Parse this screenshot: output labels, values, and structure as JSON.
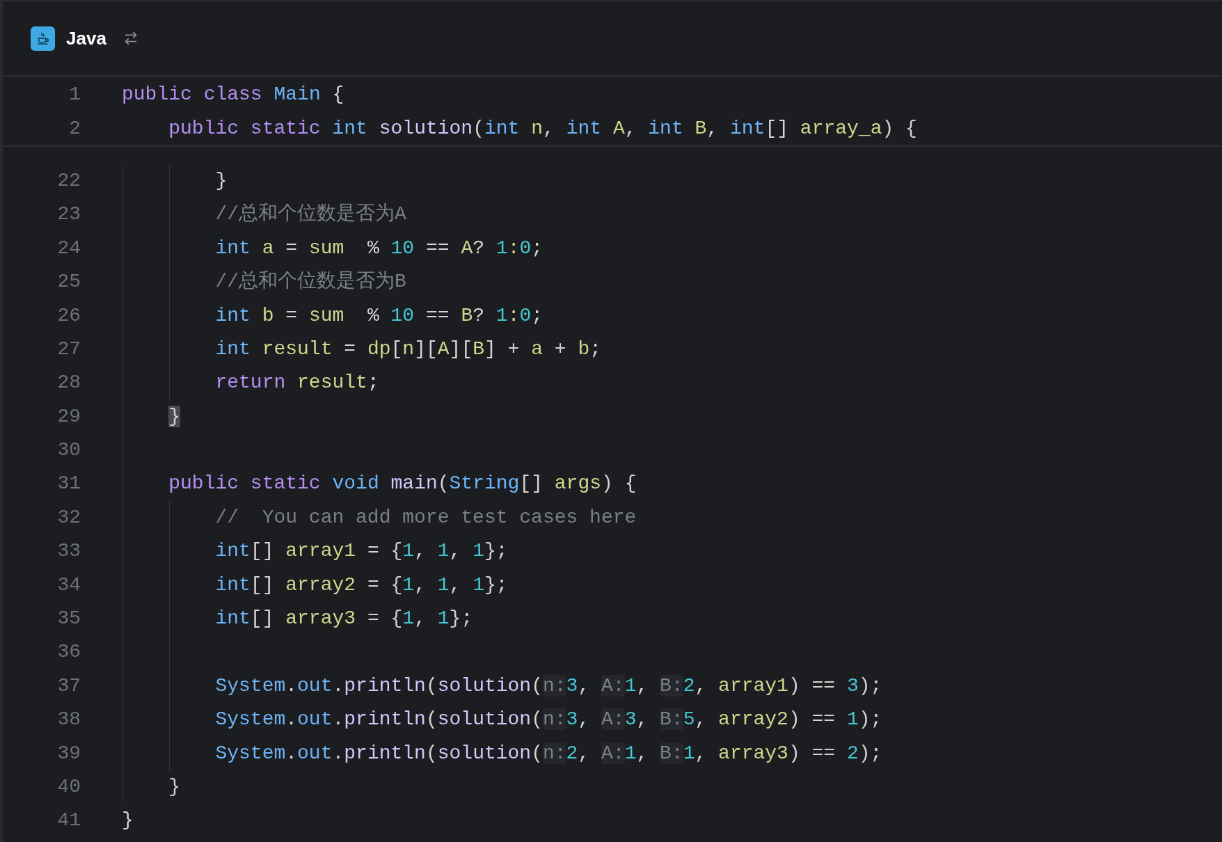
{
  "tab": {
    "language": "Java"
  },
  "sticky_lines": [
    {
      "number": "1",
      "tokens": [
        {
          "kind": "keyword",
          "text": "public"
        },
        {
          "kind": "keyword",
          "text": " class"
        },
        {
          "kind": "type",
          "text": " Main"
        },
        {
          "kind": "plain",
          "text": " {"
        }
      ]
    },
    {
      "number": "2",
      "tokens": [
        {
          "kind": "keyword",
          "text": "    public"
        },
        {
          "kind": "keyword",
          "text": " static"
        },
        {
          "kind": "type",
          "text": " int"
        },
        {
          "kind": "function",
          "text": " solution"
        },
        {
          "kind": "plain",
          "text": "("
        },
        {
          "kind": "type",
          "text": "int"
        },
        {
          "kind": "variable",
          "text": " n"
        },
        {
          "kind": "plain",
          "text": ","
        },
        {
          "kind": "type",
          "text": " int"
        },
        {
          "kind": "variable",
          "text": " A"
        },
        {
          "kind": "plain",
          "text": ","
        },
        {
          "kind": "type",
          "text": " int"
        },
        {
          "kind": "variable",
          "text": " B"
        },
        {
          "kind": "plain",
          "text": ","
        },
        {
          "kind": "type",
          "text": " int"
        },
        {
          "kind": "plain",
          "text": "[]"
        },
        {
          "kind": "variable",
          "text": " array_a"
        },
        {
          "kind": "plain",
          "text": ") {"
        }
      ]
    }
  ],
  "lines": [
    {
      "number": "22",
      "tokens": [
        {
          "kind": "plain",
          "text": "        }"
        }
      ]
    },
    {
      "number": "23",
      "tokens": [
        {
          "kind": "comment",
          "text": "        //总和个位数是否为A"
        }
      ]
    },
    {
      "number": "24",
      "tokens": [
        {
          "kind": "type",
          "text": "        int"
        },
        {
          "kind": "variable",
          "text": " a"
        },
        {
          "kind": "plain",
          "text": " ="
        },
        {
          "kind": "variable",
          "text": " sum"
        },
        {
          "kind": "plain",
          "text": "  % "
        },
        {
          "kind": "number",
          "text": "10"
        },
        {
          "kind": "plain",
          "text": " =="
        },
        {
          "kind": "variable",
          "text": " A"
        },
        {
          "kind": "plain",
          "text": "?"
        },
        {
          "kind": "number",
          "text": " 1"
        },
        {
          "kind": "variable",
          "text": ":"
        },
        {
          "kind": "number",
          "text": "0"
        },
        {
          "kind": "plain",
          "text": ";"
        }
      ]
    },
    {
      "number": "25",
      "tokens": [
        {
          "kind": "comment",
          "text": "        //总和个位数是否为B"
        }
      ]
    },
    {
      "number": "26",
      "tokens": [
        {
          "kind": "type",
          "text": "        int"
        },
        {
          "kind": "variable",
          "text": " b"
        },
        {
          "kind": "plain",
          "text": " ="
        },
        {
          "kind": "variable",
          "text": " sum"
        },
        {
          "kind": "plain",
          "text": "  % "
        },
        {
          "kind": "number",
          "text": "10"
        },
        {
          "kind": "plain",
          "text": " =="
        },
        {
          "kind": "variable",
          "text": " B"
        },
        {
          "kind": "plain",
          "text": "?"
        },
        {
          "kind": "number",
          "text": " 1"
        },
        {
          "kind": "variable",
          "text": ":"
        },
        {
          "kind": "number",
          "text": "0"
        },
        {
          "kind": "plain",
          "text": ";"
        }
      ]
    },
    {
      "number": "27",
      "tokens": [
        {
          "kind": "type",
          "text": "        int"
        },
        {
          "kind": "variable",
          "text": " result"
        },
        {
          "kind": "plain",
          "text": " ="
        },
        {
          "kind": "variable",
          "text": " dp"
        },
        {
          "kind": "plain",
          "text": "["
        },
        {
          "kind": "variable",
          "text": "n"
        },
        {
          "kind": "plain",
          "text": "]["
        },
        {
          "kind": "variable",
          "text": "A"
        },
        {
          "kind": "plain",
          "text": "]["
        },
        {
          "kind": "variable",
          "text": "B"
        },
        {
          "kind": "plain",
          "text": "] +"
        },
        {
          "kind": "variable",
          "text": " a"
        },
        {
          "kind": "plain",
          "text": " +"
        },
        {
          "kind": "variable",
          "text": " b"
        },
        {
          "kind": "plain",
          "text": ";"
        }
      ]
    },
    {
      "number": "28",
      "tokens": [
        {
          "kind": "keyword",
          "text": "        return"
        },
        {
          "kind": "variable",
          "text": " result"
        },
        {
          "kind": "plain",
          "text": ";"
        }
      ]
    },
    {
      "number": "29",
      "tokens": [
        {
          "kind": "brace_match",
          "text": "    }"
        }
      ]
    },
    {
      "number": "30"
    },
    {
      "number": "31",
      "tokens": [
        {
          "kind": "keyword",
          "text": "    public"
        },
        {
          "kind": "keyword",
          "text": " static"
        },
        {
          "kind": "type",
          "text": " void"
        },
        {
          "kind": "function",
          "text": " main"
        },
        {
          "kind": "plain",
          "text": "("
        },
        {
          "kind": "type",
          "text": "String"
        },
        {
          "kind": "plain",
          "text": "[]"
        },
        {
          "kind": "variable",
          "text": " args"
        },
        {
          "kind": "plain",
          "text": ") {"
        }
      ]
    },
    {
      "number": "32",
      "tokens": [
        {
          "kind": "comment",
          "text": "        //  You can add more test cases here"
        }
      ]
    },
    {
      "number": "33",
      "tokens": [
        {
          "kind": "type",
          "text": "        int"
        },
        {
          "kind": "plain",
          "text": "[]"
        },
        {
          "kind": "variable",
          "text": " array1"
        },
        {
          "kind": "plain",
          "text": " = {"
        },
        {
          "kind": "number",
          "text": "1"
        },
        {
          "kind": "plain",
          "text": ","
        },
        {
          "kind": "number",
          "text": " 1"
        },
        {
          "kind": "plain",
          "text": ","
        },
        {
          "kind": "number",
          "text": " 1"
        },
        {
          "kind": "plain",
          "text": "};"
        }
      ]
    },
    {
      "number": "34",
      "tokens": [
        {
          "kind": "type",
          "text": "        int"
        },
        {
          "kind": "plain",
          "text": "[]"
        },
        {
          "kind": "variable",
          "text": " array2"
        },
        {
          "kind": "plain",
          "text": " = {"
        },
        {
          "kind": "number",
          "text": "1"
        },
        {
          "kind": "plain",
          "text": ","
        },
        {
          "kind": "number",
          "text": " 1"
        },
        {
          "kind": "plain",
          "text": ","
        },
        {
          "kind": "number",
          "text": " 1"
        },
        {
          "kind": "plain",
          "text": "};"
        }
      ]
    },
    {
      "number": "35",
      "tokens": [
        {
          "kind": "type",
          "text": "        int"
        },
        {
          "kind": "plain",
          "text": "[]"
        },
        {
          "kind": "variable",
          "text": " array3"
        },
        {
          "kind": "plain",
          "text": " = {"
        },
        {
          "kind": "number",
          "text": "1"
        },
        {
          "kind": "plain",
          "text": ","
        },
        {
          "kind": "number",
          "text": " 1"
        },
        {
          "kind": "plain",
          "text": "};"
        }
      ]
    },
    {
      "number": "36"
    },
    {
      "number": "37",
      "tokens": [
        {
          "kind": "type",
          "text": "        System"
        },
        {
          "kind": "plain",
          "text": "."
        },
        {
          "kind": "type",
          "text": "out"
        },
        {
          "kind": "plain",
          "text": "."
        },
        {
          "kind": "function",
          "text": "println"
        },
        {
          "kind": "plain",
          "text": "("
        },
        {
          "kind": "function",
          "text": "solution"
        },
        {
          "kind": "plain",
          "text": "("
        },
        {
          "kind": "hint",
          "text": "n:"
        },
        {
          "kind": "number",
          "text": "3"
        },
        {
          "kind": "plain",
          "text": ","
        },
        {
          "kind": "hint",
          "text": " A:"
        },
        {
          "kind": "number",
          "text": "1"
        },
        {
          "kind": "plain",
          "text": ","
        },
        {
          "kind": "hint",
          "text": " B:"
        },
        {
          "kind": "number",
          "text": "2"
        },
        {
          "kind": "plain",
          "text": ","
        },
        {
          "kind": "variable",
          "text": " array1"
        },
        {
          "kind": "plain",
          "text": ") =="
        },
        {
          "kind": "number",
          "text": " 3"
        },
        {
          "kind": "plain",
          "text": ");"
        }
      ]
    },
    {
      "number": "38",
      "tokens": [
        {
          "kind": "type",
          "text": "        System"
        },
        {
          "kind": "plain",
          "text": "."
        },
        {
          "kind": "type",
          "text": "out"
        },
        {
          "kind": "plain",
          "text": "."
        },
        {
          "kind": "function",
          "text": "println"
        },
        {
          "kind": "plain",
          "text": "("
        },
        {
          "kind": "function",
          "text": "solution"
        },
        {
          "kind": "plain",
          "text": "("
        },
        {
          "kind": "hint",
          "text": "n:"
        },
        {
          "kind": "number",
          "text": "3"
        },
        {
          "kind": "plain",
          "text": ","
        },
        {
          "kind": "hint",
          "text": " A:"
        },
        {
          "kind": "number",
          "text": "3"
        },
        {
          "kind": "plain",
          "text": ","
        },
        {
          "kind": "hint",
          "text": " B:"
        },
        {
          "kind": "number",
          "text": "5"
        },
        {
          "kind": "plain",
          "text": ","
        },
        {
          "kind": "variable",
          "text": " array2"
        },
        {
          "kind": "plain",
          "text": ") =="
        },
        {
          "kind": "number",
          "text": " 1"
        },
        {
          "kind": "plain",
          "text": ");"
        }
      ]
    },
    {
      "number": "39",
      "tokens": [
        {
          "kind": "type",
          "text": "        System"
        },
        {
          "kind": "plain",
          "text": "."
        },
        {
          "kind": "type",
          "text": "out"
        },
        {
          "kind": "plain",
          "text": "."
        },
        {
          "kind": "function",
          "text": "println"
        },
        {
          "kind": "plain",
          "text": "("
        },
        {
          "kind": "function",
          "text": "solution"
        },
        {
          "kind": "plain",
          "text": "("
        },
        {
          "kind": "hint",
          "text": "n:"
        },
        {
          "kind": "number",
          "text": "2"
        },
        {
          "kind": "plain",
          "text": ","
        },
        {
          "kind": "hint",
          "text": " A:"
        },
        {
          "kind": "number",
          "text": "1"
        },
        {
          "kind": "plain",
          "text": ","
        },
        {
          "kind": "hint",
          "text": " B:"
        },
        {
          "kind": "number",
          "text": "1"
        },
        {
          "kind": "plain",
          "text": ","
        },
        {
          "kind": "variable",
          "text": " array3"
        },
        {
          "kind": "plain",
          "text": ") =="
        },
        {
          "kind": "number",
          "text": " 2"
        },
        {
          "kind": "plain",
          "text": ");"
        }
      ]
    },
    {
      "number": "40",
      "tokens": [
        {
          "kind": "plain",
          "text": "    }"
        }
      ]
    },
    {
      "number": "41",
      "tokens": [
        {
          "kind": "plain",
          "text": "}"
        }
      ]
    }
  ]
}
